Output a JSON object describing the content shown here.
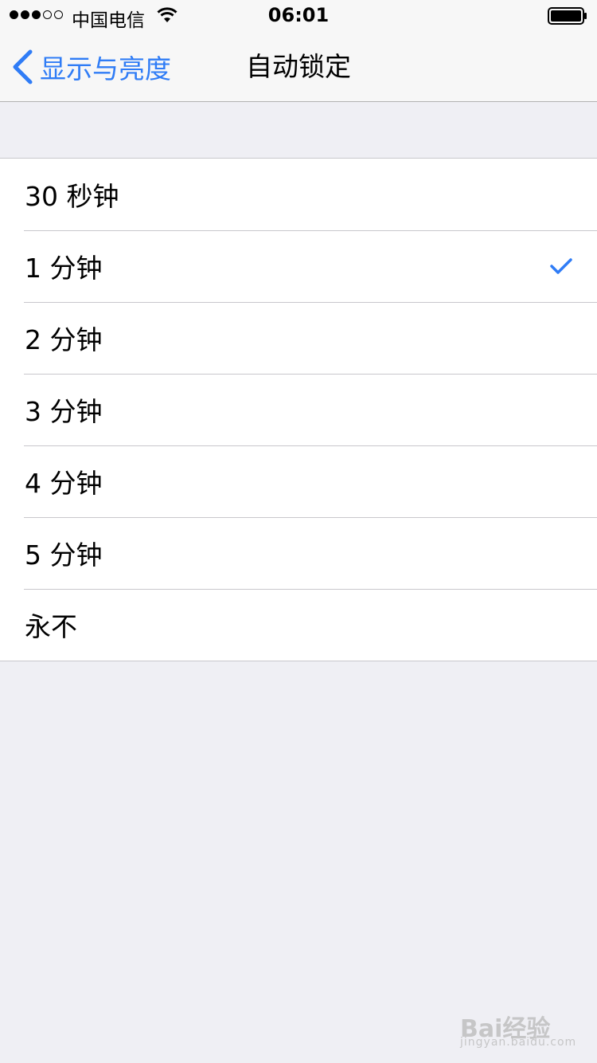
{
  "status_bar": {
    "carrier": "中国电信",
    "time": "06:01",
    "signal_strength": 3,
    "signal_total": 5
  },
  "nav": {
    "back_label": "显示与亮度",
    "title": "自动锁定"
  },
  "options": [
    {
      "label": "30 秒钟",
      "selected": false
    },
    {
      "label": "1 分钟",
      "selected": true
    },
    {
      "label": "2 分钟",
      "selected": false
    },
    {
      "label": "3 分钟",
      "selected": false
    },
    {
      "label": "4 分钟",
      "selected": false
    },
    {
      "label": "5 分钟",
      "selected": false
    },
    {
      "label": "永不",
      "selected": false
    }
  ],
  "watermark": {
    "logo_text": "Bai经验",
    "url": "jingyan.baidu.com"
  },
  "colors": {
    "accent": "#2f7cf6",
    "background": "#efeff4"
  }
}
